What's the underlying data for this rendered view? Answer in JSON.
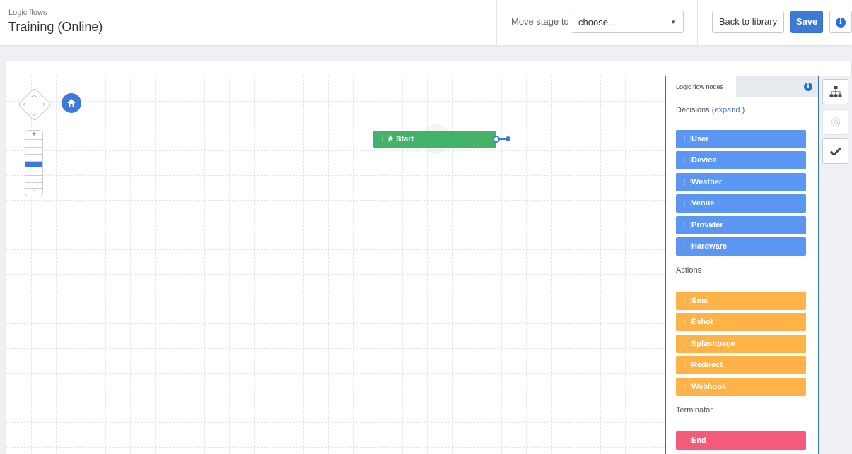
{
  "header": {
    "breadcrumb": "Logic flows",
    "title": "Training (Online)",
    "move_stage_label": "Move stage to",
    "move_stage_select": "choose...",
    "back_label": "Back to library",
    "save_label": "Save",
    "info_glyph": "i"
  },
  "canvas": {
    "zoom_plus": "+",
    "zoom_minus": "-",
    "start_node_label": "Start",
    "icons": [
      "pan-control-icon",
      "home-icon"
    ]
  },
  "panel": {
    "tab_label": "Logic flow nodes",
    "info_glyph": "i",
    "decisions": {
      "title": "Decisions",
      "expand_open": "(",
      "expand_link": "expand",
      "expand_close": ")",
      "items": [
        "User",
        "Device",
        "Weather",
        "Venue",
        "Provider",
        "Hardware"
      ]
    },
    "actions": {
      "title": "Actions",
      "items": [
        "Sms",
        "Eshot",
        "Splashpage",
        "Redirect",
        "Webhook"
      ]
    },
    "terminator": {
      "title": "Terminator",
      "items": [
        "End"
      ]
    }
  },
  "toolbar": {
    "icons": [
      "hierarchy-icon",
      "gear-icon",
      "checkmark-icon"
    ]
  },
  "colors": {
    "accent": "#3d7ad8",
    "start_node": "#43b36a",
    "decision": "#5b97f2",
    "action": "#ffb347",
    "terminator": "#f45b7a"
  }
}
